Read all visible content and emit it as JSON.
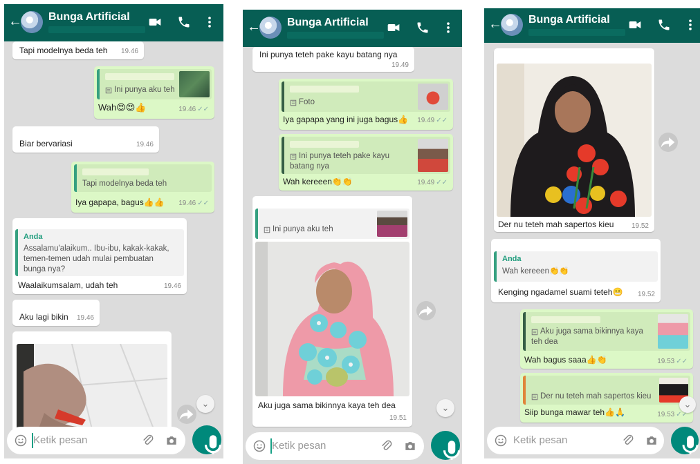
{
  "contact": {
    "name": "Bunga Artificial"
  },
  "input": {
    "placeholder": "Ketik pesan"
  },
  "colors": {
    "header": "#075e54",
    "outgoing": "#dcf8c6",
    "incoming": "#ffffff",
    "accent": "#00897b",
    "chat_bg": "#dcdcdc"
  },
  "icons": [
    "back-arrow-icon",
    "video-call-icon",
    "phone-icon",
    "menu-dots-icon",
    "emoji-icon",
    "attach-icon",
    "camera-icon",
    "mic-icon",
    "forward-icon",
    "scroll-down-icon",
    "read-check-icon",
    "document-icon"
  ],
  "screen1": {
    "m1": {
      "text": "Tapi modelnya beda teh",
      "time": "19.46"
    },
    "m2": {
      "quote": "Ini punya aku teh",
      "text": "Wah😍😍👍",
      "time": "19.46"
    },
    "m3": {
      "text": "Biar bervariasi",
      "time": "19.46"
    },
    "m4": {
      "quote": "Tapi modelnya beda teh",
      "text": "Iya gapapa, bagus👍👍",
      "time": "19.46"
    },
    "m5": {
      "quote_author": "Anda",
      "quote_line1": "Assalamu'alaikum.. Ibu-ibu, kakak-kakak,",
      "quote_line2": "temen-temen udah mulai pembuatan",
      "quote_line3": "bunga nya?",
      "text": "Waalaikumsalam, udah teh",
      "time": "19.46"
    },
    "m6": {
      "text": "Aku lagi bikin",
      "time": "19.46"
    }
  },
  "screen2": {
    "m1": {
      "text": "Ini punya teteh pake kayu batang nya",
      "time": "19.49"
    },
    "m2": {
      "quote": "Foto",
      "text": "Iya gapapa yang ini juga bagus👍",
      "time": "19.49"
    },
    "m3": {
      "quote_line1": "Ini punya teteh pake kayu",
      "quote_line2": "batang nya",
      "text": "Wah kereeen👏👏",
      "time": "19.49"
    },
    "m4": {
      "quote": "Ini punya aku teh",
      "text": "Aku juga sama bikinnya kaya teh dea",
      "time": "19.51"
    }
  },
  "screen3": {
    "m1": {
      "text": "Der nu teteh mah sapertos kieu",
      "time": "19.52"
    },
    "m2": {
      "quote_author": "Anda",
      "quote": "Wah kereeen👏👏",
      "text": "Kenging ngadamel suami teteh😬",
      "time": "19.52"
    },
    "m3": {
      "quote_line1": "Aku juga sama bikinnya kaya",
      "quote_line2": "teh dea",
      "text": "Wah bagus saaa👍👏",
      "time": "19.53"
    },
    "m4": {
      "quote": "Der nu teteh mah sapertos kieu",
      "text": "Siip bunga mawar teh👍🙏",
      "time": "19.53"
    }
  }
}
